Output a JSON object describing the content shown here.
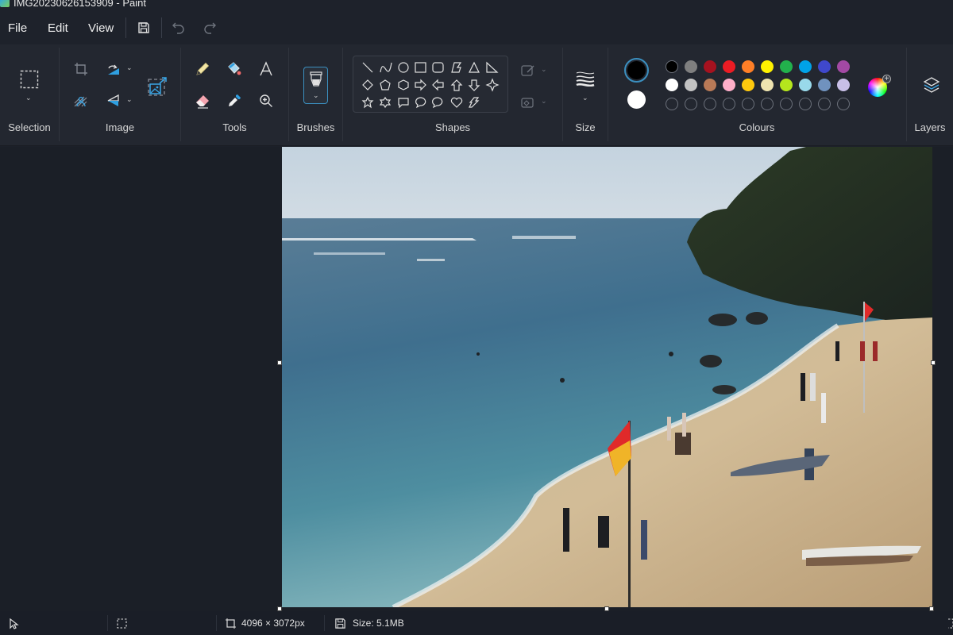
{
  "window": {
    "title": "IMG20230626153909 - Paint",
    "app_icon": "paint-app-icon"
  },
  "menu": {
    "items": [
      {
        "label": "File"
      },
      {
        "label": "Edit"
      },
      {
        "label": "View"
      }
    ],
    "quick_actions": [
      {
        "name": "save",
        "icon": "save-icon"
      },
      {
        "name": "undo",
        "icon": "undo-icon",
        "enabled": false
      },
      {
        "name": "redo",
        "icon": "redo-icon",
        "enabled": false
      }
    ]
  },
  "ribbon": {
    "groups": [
      {
        "label": "Selection",
        "tools": [
          "rectangle-select"
        ]
      },
      {
        "label": "Image",
        "tools": [
          "crop",
          "rotate",
          "remove-background",
          "flip",
          "resize"
        ]
      },
      {
        "label": "Tools",
        "tools": [
          "pencil",
          "fill",
          "text",
          "eraser",
          "color-picker",
          "magnifier"
        ]
      },
      {
        "label": "Brushes",
        "tools": [
          "brush"
        ]
      },
      {
        "label": "Shapes",
        "tools": [
          "line",
          "curve",
          "oval",
          "rectangle",
          "rounded-rectangle",
          "polygon",
          "triangle",
          "right-triangle",
          "diamond",
          "pentagon",
          "hexagon",
          "right-arrow",
          "left-arrow",
          "up-arrow",
          "down-arrow",
          "four-point-star",
          "five-point-star",
          "six-point-star",
          "rounded-callout",
          "oval-callout",
          "cloud-callout",
          "heart",
          "lightning"
        ],
        "extras": [
          "outline",
          "fill"
        ]
      },
      {
        "label": "Size"
      },
      {
        "label": "Colours"
      },
      {
        "label": "Layers"
      }
    ],
    "colours": {
      "primary": "#000000",
      "secondary": "#ffffff",
      "palette_row1": [
        "#000000",
        "#7f7f7f",
        "#a6121f",
        "#ec1c24",
        "#ff7f27",
        "#fff200",
        "#22b14c",
        "#00a2e8",
        "#3f48cc",
        "#a349a4"
      ],
      "palette_row2": [
        "#ffffff",
        "#c3c3c3",
        "#b97a57",
        "#ffaec9",
        "#ffc90e",
        "#efe4b0",
        "#b5e61d",
        "#99d9ea",
        "#7092be",
        "#c8bfe7"
      ],
      "custom_slots": 10,
      "edit_colours_icon": "colour-wheel-icon"
    }
  },
  "canvas": {
    "image_description": "Beach scene with sea, cliff, flags and people",
    "selection_handles": true
  },
  "status": {
    "pointer_icon": "pointer-icon",
    "selection_icon": "selection-size-icon",
    "dimensions": "4096 × 3072px",
    "size": "Size: 5.1MB"
  }
}
